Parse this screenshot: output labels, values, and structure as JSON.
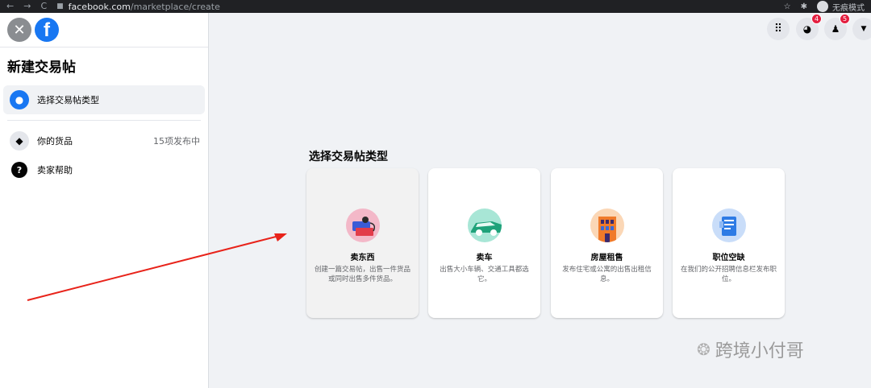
{
  "browser": {
    "back": "←",
    "forward": "→",
    "reload": "C",
    "url_host": "facebook.com",
    "url_path": "/marketplace/create",
    "star": "☆",
    "extensions": "✱",
    "profile_label": "无痕模式"
  },
  "sidebar": {
    "close_icon": "✕",
    "logo_letter": "f",
    "title": "新建交易帖",
    "items": [
      {
        "label": "选择交易帖类型",
        "icon": "tag-icon",
        "glyph": "●"
      },
      {
        "label": "你的货品",
        "icon": "tag-icon",
        "glyph": "◆",
        "count": "15项发布中"
      },
      {
        "label": "卖家帮助",
        "icon": "help-icon",
        "glyph": "?"
      }
    ]
  },
  "header_buttons": {
    "menu_glyph": "⠿",
    "messenger_glyph": "◕",
    "messenger_badge": "4",
    "notifications_glyph": "♟",
    "notifications_badge": "5",
    "account_glyph": "▼"
  },
  "main": {
    "title": "选择交易帖类型",
    "cards": [
      {
        "title": "卖东西",
        "desc": "创建一篇交易帖，出售一件货品或同时出售多件货品。",
        "icon": "item-icon",
        "color": "#f3b8c8"
      },
      {
        "title": "卖车",
        "desc": "出售大小车辆、交通工具都选它。",
        "icon": "car-icon",
        "color": "#a8e6d6"
      },
      {
        "title": "房屋租售",
        "desc": "发布住宅或公寓的出售出租信息。",
        "icon": "house-icon",
        "color": "#fbd7b6"
      },
      {
        "title": "职位空缺",
        "desc": "在我们的公开招聘信息栏发布职位。",
        "icon": "job-icon",
        "color": "#c9ddf9"
      }
    ]
  },
  "watermark": {
    "text": "跨境小付哥"
  },
  "colors": {
    "accent": "#1877f2",
    "arrow": "#e8231a"
  }
}
